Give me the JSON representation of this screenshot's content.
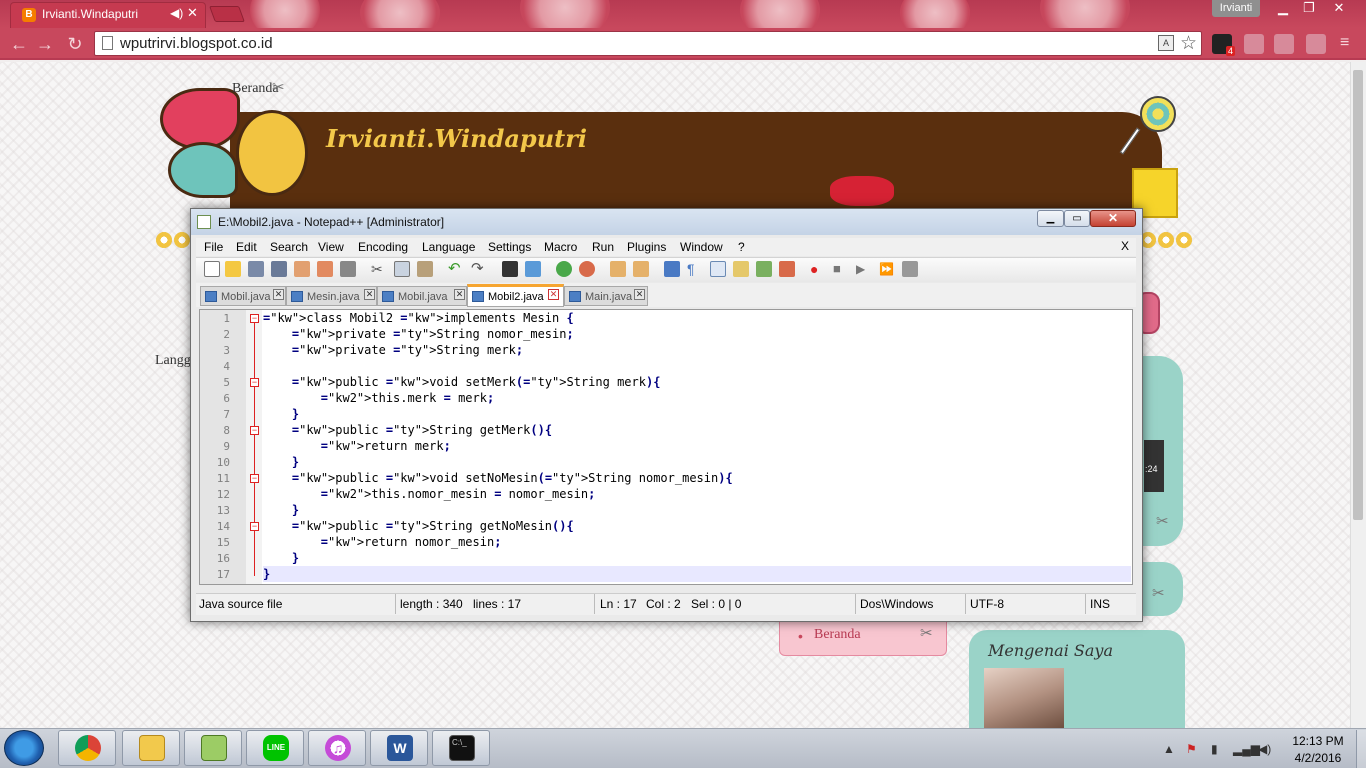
{
  "browser": {
    "tab_title": "Irvianti.Windaputri",
    "favicon_letter": "B",
    "profile_name": "Irvianti",
    "url": "wputrirvi.blogspot.co.id",
    "extension_badge": "4"
  },
  "blog": {
    "nav_link": "Beranda",
    "title": "Irvianti.Windaputri",
    "partial_text": "Langg",
    "sidebar_link": "Beranda",
    "about_title": "Mengenai Saya",
    "player_time": ":24"
  },
  "notepad": {
    "window_title": "E:\\Mobil2.java - Notepad++ [Administrator]",
    "menu": [
      "File",
      "Edit",
      "Search",
      "View",
      "Encoding",
      "Language",
      "Settings",
      "Macro",
      "Run",
      "Plugins",
      "Window",
      "?"
    ],
    "doc_close": "X",
    "tabs": [
      {
        "label": "Mobil.java",
        "active": false
      },
      {
        "label": "Mesin.java",
        "active": false
      },
      {
        "label": "Mobil.java",
        "active": false
      },
      {
        "label": "Mobil2.java",
        "active": true
      },
      {
        "label": "Main.java",
        "active": false
      }
    ],
    "line_numbers": [
      "1",
      "2",
      "3",
      "4",
      "5",
      "6",
      "7",
      "8",
      "9",
      "10",
      "11",
      "12",
      "13",
      "14",
      "15",
      "16",
      "17"
    ],
    "code_lines": [
      "class Mobil2 implements Mesin {",
      "    private String nomor_mesin;",
      "    private String merk;",
      "",
      "    public void setMerk(String merk){",
      "        this.merk = merk;",
      "    }",
      "    public String getMerk(){",
      "        return merk;",
      "    }",
      "    public void setNoMesin(String nomor_mesin){",
      "        this.nomor_mesin = nomor_mesin;",
      "    }",
      "    public String getNoMesin(){",
      "        return nomor_mesin;",
      "    }",
      "}"
    ],
    "status": {
      "file_type": "Java source file",
      "length": "length : 340",
      "lines": "lines : 17",
      "ln": "Ln : 17",
      "col": "Col : 2",
      "sel": "Sel : 0 | 0",
      "eol": "Dos\\Windows",
      "encoding": "UTF-8",
      "mode": "INS"
    }
  },
  "taskbar": {
    "time": "12:13 PM",
    "date": "4/2/2016",
    "apps": [
      "chrome-icon",
      "explorer-icon",
      "notepadpp-icon",
      "line-icon",
      "itunes-icon",
      "word-icon",
      "cmd-icon"
    ]
  },
  "colors": {
    "chrome_frame": "#c8485d",
    "header_band": "#5a2f0e",
    "blog_title": "#f3c84a",
    "teal_widget": "#9ad3c8",
    "keyword_purple": "#8000ff",
    "keyword_blue": "#0000ff"
  }
}
